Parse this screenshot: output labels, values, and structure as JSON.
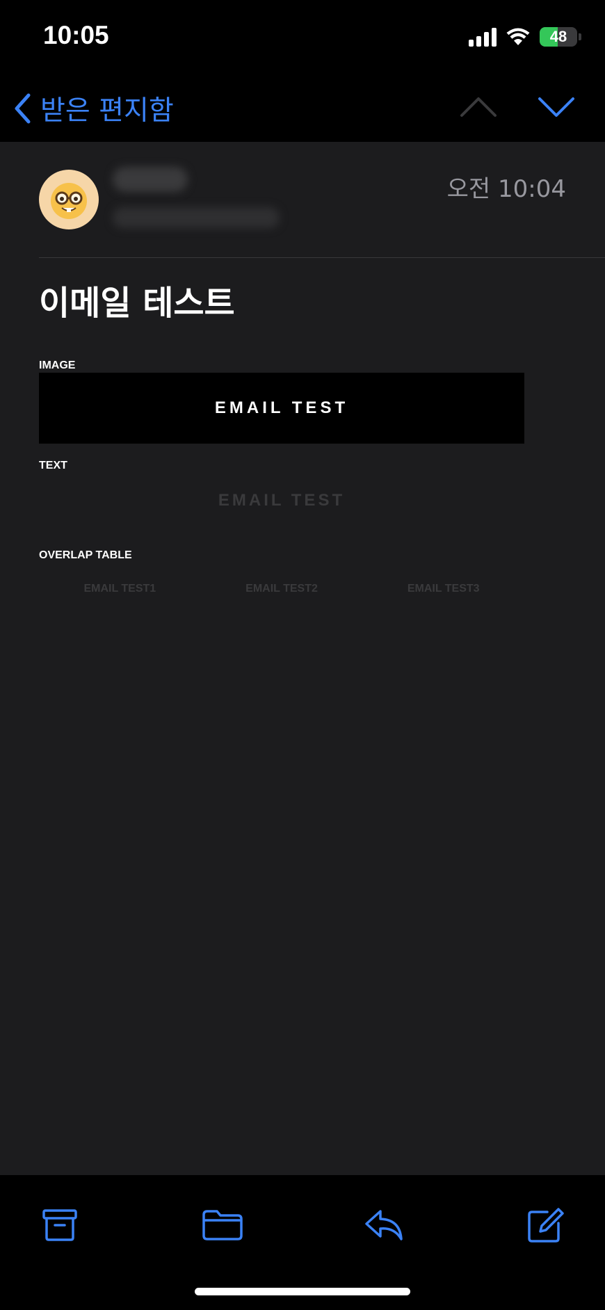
{
  "status_bar": {
    "time": "10:05",
    "battery_percent": "48",
    "battery_level": 0.48
  },
  "nav": {
    "back_label": "받은 편지함"
  },
  "email": {
    "received_time": "오전 10:04",
    "subject": "이메일 테스트"
  },
  "body": {
    "image_label": "IMAGE",
    "image_text": "EMAIL TEST",
    "text_label": "TEXT",
    "text_content": "EMAIL TEST",
    "overlap_label": "OVERLAP TABLE",
    "overlap_cells": [
      "EMAIL TEST1",
      "EMAIL TEST2",
      "EMAIL TEST3"
    ]
  },
  "toolbar": {
    "icons": [
      "archive-icon",
      "folder-icon",
      "reply-icon",
      "compose-icon"
    ]
  },
  "colors": {
    "accent": "#3b82f6",
    "background": "#1c1c1e",
    "bar": "#000000",
    "muted_text": "#3a3a3c",
    "secondary_text": "#98989f",
    "battery": "#34c759"
  }
}
